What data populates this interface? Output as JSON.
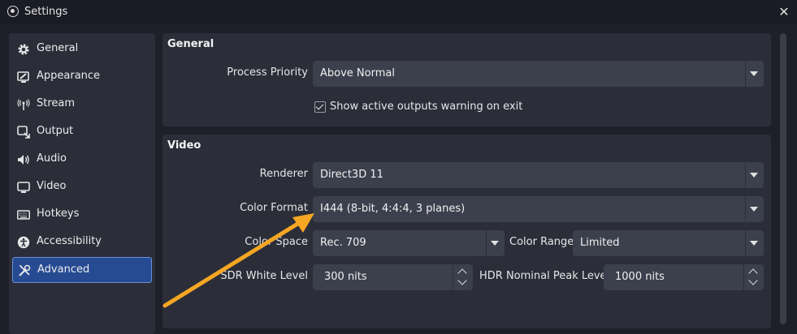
{
  "window": {
    "title": "Settings",
    "icon": "obs-logo-icon",
    "close_icon": "close-icon"
  },
  "sidebar": {
    "items": [
      {
        "label": "General",
        "icon": "gear-icon"
      },
      {
        "label": "Appearance",
        "icon": "monitor-brush-icon"
      },
      {
        "label": "Stream",
        "icon": "antenna-icon"
      },
      {
        "label": "Output",
        "icon": "output-icon"
      },
      {
        "label": "Audio",
        "icon": "speaker-icon"
      },
      {
        "label": "Video",
        "icon": "monitor-icon"
      },
      {
        "label": "Hotkeys",
        "icon": "keyboard-icon"
      },
      {
        "label": "Accessibility",
        "icon": "accessibility-icon"
      },
      {
        "label": "Advanced",
        "icon": "tools-icon",
        "selected": true
      }
    ]
  },
  "general": {
    "title": "General",
    "process_priority_label": "Process Priority",
    "process_priority_value": "Above Normal",
    "show_warning_label": "Show active outputs warning on exit",
    "show_warning_checked": true
  },
  "video": {
    "title": "Video",
    "renderer_label": "Renderer",
    "renderer_value": "Direct3D 11",
    "color_format_label": "Color Format",
    "color_format_value": "I444 (8-bit, 4:4:4, 3 planes)",
    "color_space_label": "Color Space",
    "color_space_value": "Rec. 709",
    "color_range_label": "Color Range",
    "color_range_value": "Limited",
    "sdr_white_label": "SDR White Level",
    "sdr_white_value": "300 nits",
    "hdr_peak_label": "HDR Nominal Peak Level",
    "hdr_peak_value": "1000 nits"
  },
  "colors": {
    "accent": "#274b93",
    "annotation_arrow": "#f5a623",
    "panel": "#2b2e38",
    "background": "#1e1f29"
  }
}
